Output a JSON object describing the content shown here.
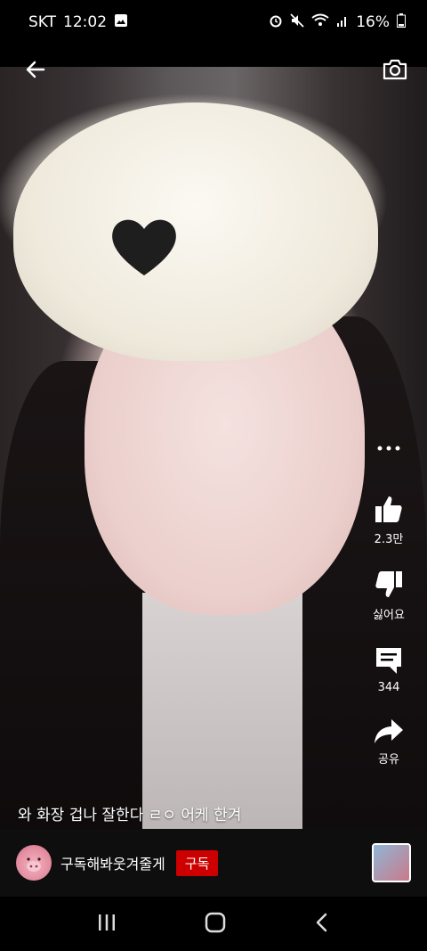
{
  "status_bar": {
    "carrier": "SKT",
    "time": "12:02",
    "battery": "16%"
  },
  "video": {
    "caption": "와 화장 겁나 잘한다 ㄹㅇ 어케 한겨"
  },
  "actions": {
    "like_count": "2.3만",
    "dislike_label": "싫어요",
    "comment_count": "344",
    "share_label": "공유"
  },
  "channel": {
    "name": "구독해봐웃겨줄게",
    "subscribe_label": "구독"
  },
  "icons": {
    "back": "arrow-left-icon",
    "camera": "camera-icon",
    "more": "more-horizontal-icon",
    "like": "thumbs-up-icon",
    "dislike": "thumbs-down-icon",
    "comment": "comment-icon",
    "share": "share-icon"
  },
  "colors": {
    "subscribe": "#cc0000",
    "background": "#000000"
  }
}
